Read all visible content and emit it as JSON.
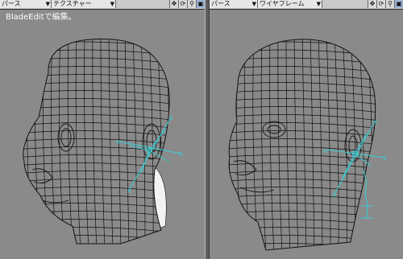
{
  "left_viewport": {
    "view_dropdown": "パース",
    "shading_dropdown": "テクスチャー",
    "label": "BladeEditで編集。"
  },
  "right_viewport": {
    "view_dropdown": "パース",
    "shading_dropdown": "ワイヤフレーム"
  },
  "toolbar_icons": [
    "move-view-icon",
    "rotate-view-icon",
    "zoom-view-icon",
    "maximize-view-icon"
  ],
  "colors": {
    "background": "#8a8a8a",
    "wire": "#111111",
    "bone": "#35d0d8",
    "mesh_surface": "#f2f2f2"
  }
}
